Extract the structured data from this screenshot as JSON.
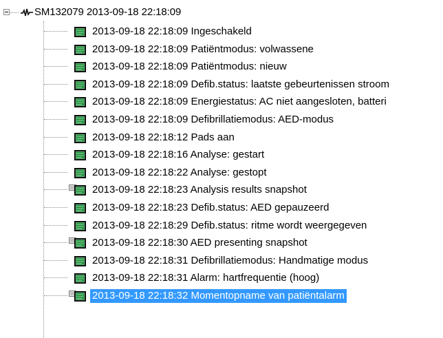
{
  "tree": {
    "root": {
      "label": "SM132079 2013-09-18 22:18:09",
      "expander": "collapse-icon",
      "icon": "ecg-waveform-icon"
    },
    "items": [
      {
        "label": "2013-09-18 22:18:09 Ingeschakeld",
        "icon": "monitor-icon"
      },
      {
        "label": "2013-09-18 22:18:09 Patiëntmodus: volwassene",
        "icon": "monitor-icon"
      },
      {
        "label": "2013-09-18 22:18:09 Patiëntmodus: nieuw",
        "icon": "monitor-icon"
      },
      {
        "label": "2013-09-18 22:18:09 Defib.status: laatste gebeurtenissen stroom",
        "icon": "monitor-icon"
      },
      {
        "label": "2013-09-18 22:18:09 Energiestatus: AC niet aangesloten, batteri",
        "icon": "monitor-icon"
      },
      {
        "label": "2013-09-18 22:18:09 Defibrillatiemodus: AED-modus",
        "icon": "monitor-icon"
      },
      {
        "label": "2013-09-18 22:18:12 Pads aan",
        "icon": "monitor-icon"
      },
      {
        "label": "2013-09-18 22:18:16 Analyse: gestart",
        "icon": "monitor-icon"
      },
      {
        "label": "2013-09-18 22:18:22 Analyse: gestopt",
        "icon": "monitor-icon"
      },
      {
        "label": "2013-09-18 22:18:23 Analysis results snapshot",
        "icon": "snapshot-monitor-icon"
      },
      {
        "label": "2013-09-18 22:18:23 Defib.status: AED gepauzeerd",
        "icon": "monitor-icon"
      },
      {
        "label": "2013-09-18 22:18:29 Defib.status: ritme wordt weergegeven",
        "icon": "monitor-icon"
      },
      {
        "label": "2013-09-18 22:18:30 AED presenting snapshot",
        "icon": "snapshot-monitor-icon"
      },
      {
        "label": "2013-09-18 22:18:31 Defibrillatiemodus: Handmatige modus",
        "icon": "monitor-icon"
      },
      {
        "label": "2013-09-18 22:18:31 Alarm: hartfrequentie (hoog)",
        "icon": "monitor-icon"
      },
      {
        "label": "2013-09-18 22:18:32 Momentopname van patiëntalarm",
        "icon": "snapshot-monitor-icon",
        "selected": true
      }
    ]
  },
  "colors": {
    "selection": "#3399ff",
    "monitor_screen": "#1f8a3a",
    "tree_lines": "#8a8a8a"
  }
}
